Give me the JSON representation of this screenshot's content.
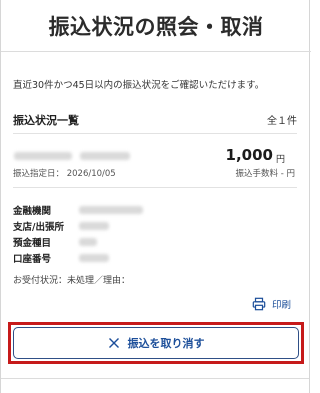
{
  "header": {
    "title": "振込状況の照会・取消"
  },
  "intro": "直近30件かつ45日以内の振込状況をご確認いただけます。",
  "list": {
    "title": "振込状況一覧",
    "count": "全１件"
  },
  "transfer": {
    "amount": "1,000",
    "currency": "円",
    "date_label": "振込指定日：",
    "date": "2026/10/05",
    "fee_label": "振込手数料 - 円",
    "details": [
      {
        "label": "金融機関"
      },
      {
        "label": "支店/出張所"
      },
      {
        "label": "預金種目"
      },
      {
        "label": "口座番号"
      }
    ],
    "status": "お受付状況：未処理／理由："
  },
  "actions": {
    "print_label": "印刷",
    "print_icon": "printer-icon",
    "cancel_label": "振込を取り消す",
    "cancel_icon": "close-icon"
  },
  "colors": {
    "accent": "#1d4f9a",
    "highlight": "#c61a1a"
  }
}
